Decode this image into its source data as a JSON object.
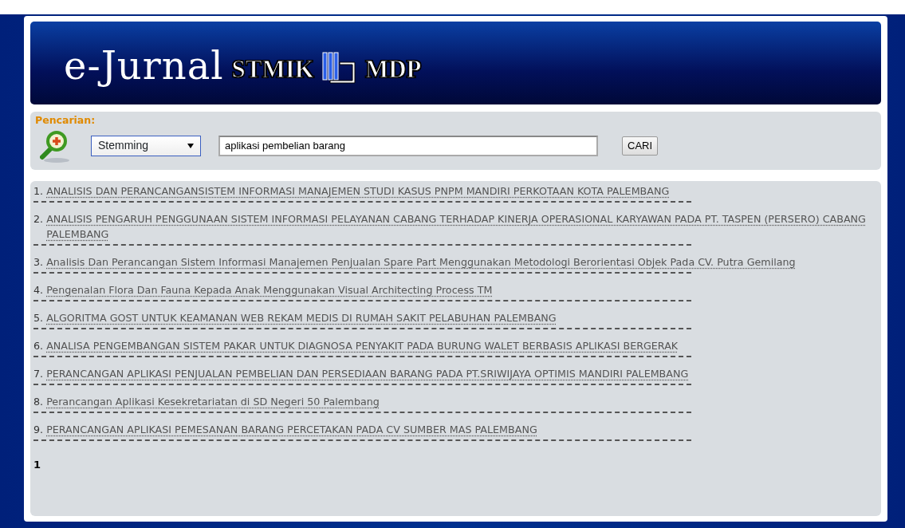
{
  "header": {
    "title": "e-Jurnal",
    "logo_left": "STMIK",
    "logo_right": "MDP"
  },
  "search": {
    "label": "Pencarian:",
    "method": "Stemming",
    "query": "aplikasi pembelian barang",
    "button": "CARI"
  },
  "results": [
    {
      "number": "1.",
      "title": "ANALISIS DAN PERANCANGANSISTEM INFORMASI MANAJEMEN STUDI KASUS PNPM MANDIRI PERKOTAAN KOTA PALEMBANG"
    },
    {
      "number": "2.",
      "title": "ANALISIS PENGARUH PENGGUNAAN SISTEM INFORMASI PELAYANAN CABANG TERHADAP KINERJA OPERASIONAL KARYAWAN PADA PT. TASPEN (PERSERO) CABANG PALEMBANG"
    },
    {
      "number": "3.",
      "title": "Analisis Dan Perancangan Sistem Informasi Manajemen Penjualan Spare Part Menggunakan Metodologi Berorientasi Objek Pada CV. Putra Gemilang"
    },
    {
      "number": "4.",
      "title": "Pengenalan Flora Dan Fauna Kepada Anak Menggunakan Visual Architecting Process TM"
    },
    {
      "number": "5.",
      "title": "ALGORITMA GOST UNTUK KEAMANAN WEB REKAM MEDIS DI RUMAH SAKIT PELABUHAN PALEMBANG"
    },
    {
      "number": "6.",
      "title": "ANALISA PENGEMBANGAN SISTEM PAKAR UNTUK DIAGNOSA PENYAKIT PADA BURUNG WALET BERBASIS APLIKASI BERGERAK"
    },
    {
      "number": "7.",
      "title": "PERANCANGAN APLIKASI PENJUALAN PEMBELIAN DAN PERSEDIAAN BARANG PADA PT.SRIWIJAYA OPTIMIS MANDIRI PALEMBANG"
    },
    {
      "number": "8.",
      "title": "Perancangan Aplikasi Kesekretariatan di SD Negeri 50 Palembang"
    },
    {
      "number": "9.",
      "title": "PERANCANGAN APLIKASI PEMESANAN BARANG PERCETAKAN PADA CV SUMBER MAS PALEMBANG"
    }
  ],
  "pagination": [
    {
      "label": "1",
      "selected": true
    }
  ]
}
